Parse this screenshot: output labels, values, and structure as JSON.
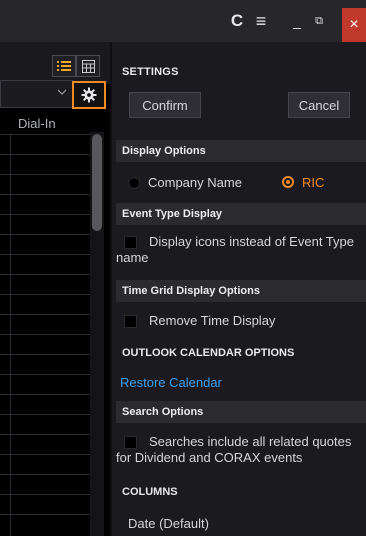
{
  "titlebar": {
    "refresh_glyph": "C",
    "menu_glyph": "≡",
    "minimize_glyph": "_",
    "restore_glyph": "⧉",
    "close_glyph": "×"
  },
  "calendar": {
    "column_header": "Dial-In"
  },
  "settings": {
    "heading": "SETTINGS",
    "confirm_label": "Confirm",
    "cancel_label": "Cancel",
    "display_options": {
      "title": "Display Options",
      "options": [
        "Company Name",
        "RIC"
      ],
      "selected": "RIC"
    },
    "event_type_display": {
      "title": "Event Type Display",
      "checkbox_label": "Display icons instead of Event Type name",
      "checked": false
    },
    "time_grid": {
      "title": "Time Grid Display Options",
      "checkbox_label": "Remove Time Display",
      "checked": false
    },
    "outlook": {
      "title": "OUTLOOK CALENDAR OPTIONS",
      "restore_link": "Restore Calendar"
    },
    "search_options": {
      "title": "Search Options",
      "checkbox_label_line1": "Searches include all related quotes",
      "checkbox_label_line2": "for Dividend and CORAX events",
      "checked": false
    },
    "columns": {
      "title": "COLUMNS",
      "items": [
        "Date (Default)"
      ]
    }
  },
  "colors": {
    "accent": "#f08a24",
    "link": "#3b9ff0",
    "close": "#c0392b"
  }
}
